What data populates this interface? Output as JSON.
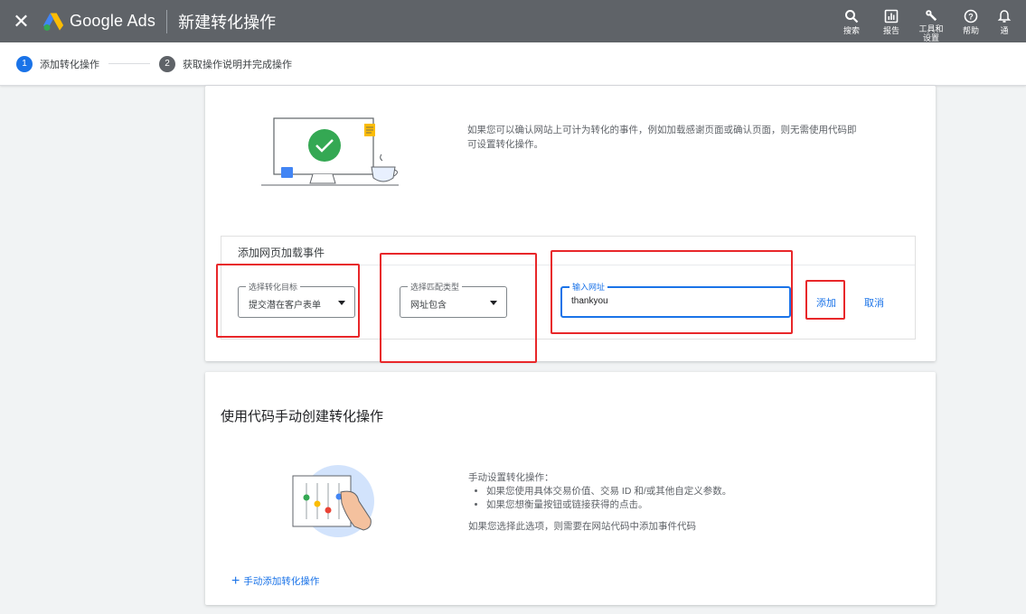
{
  "header": {
    "close_icon": "close-icon",
    "brand": "Google Ads",
    "title": "新建转化操作",
    "actions": [
      {
        "icon": "search-icon",
        "label": "搜索"
      },
      {
        "icon": "reports-icon",
        "label": "报告"
      },
      {
        "icon": "tools-icon",
        "label": "工具和设置"
      },
      {
        "icon": "help-icon",
        "label": "帮助"
      },
      {
        "icon": "bell-icon",
        "label": "通"
      }
    ]
  },
  "stepper": {
    "steps": [
      {
        "num": "1",
        "label": "添加转化操作",
        "active": true
      },
      {
        "num": "2",
        "label": "获取操作说明并完成操作",
        "active": false
      }
    ]
  },
  "card1": {
    "description": "如果您可以确认网站上可计为转化的事件，例如加载感谢页面或确认页面，则无需使用代码即可设置转化操作。",
    "event_title": "添加网页加载事件",
    "goal_select": {
      "label": "选择转化目标",
      "value": "提交潜在客户表单"
    },
    "match_select": {
      "label": "选择匹配类型",
      "value": "网址包含"
    },
    "url_input": {
      "label": "输入网址",
      "value": "thankyou"
    },
    "add_label": "添加",
    "cancel_label": "取消"
  },
  "card2": {
    "title": "使用代码手动创建转化操作",
    "intro": "手动设置转化操作：",
    "bullets": [
      "如果您使用具体交易价值、交易 ID 和/或其他自定义参数。",
      "如果您想衡量按钮或链接获得的点击。"
    ],
    "note": "如果您选择此选项，则需要在网站代码中添加事件代码",
    "manual_link": "手动添加转化操作"
  },
  "colors": {
    "topbar": "#5f6368",
    "accent": "#1a73e8",
    "highlight": "#e8272a"
  }
}
